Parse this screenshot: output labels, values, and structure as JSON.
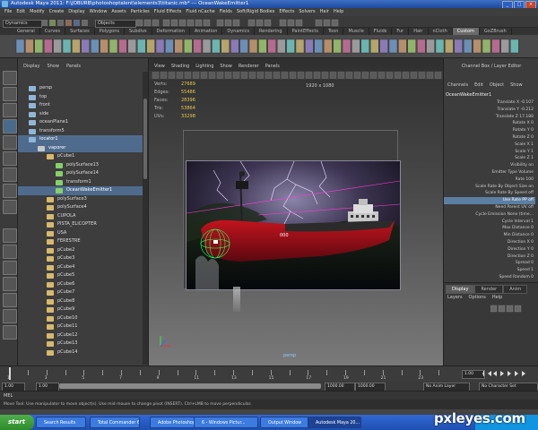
{
  "window": {
    "title": "Autodesk Maya 2011: F:\\JOBURB\\photoshoptalent\\elements3\\titanic.mb*  ---  OceanWakeEmitter1",
    "buttons": [
      "_",
      "□",
      "×"
    ]
  },
  "menubar": [
    "File",
    "Edit",
    "Modify",
    "Create",
    "Display",
    "Window",
    "Assets",
    "Particles",
    "Fluid Effects",
    "Fluid nCache",
    "Fields",
    "Soft/Rigid Bodies",
    "Effects",
    "Solvers",
    "Hair",
    "Help"
  ],
  "status_line": {
    "mode": "Dynamics",
    "selection": "Objects"
  },
  "shelf_tabs": [
    "General",
    "Curves",
    "Surfaces",
    "Polygons",
    "Subdivs",
    "Deformation",
    "Animation",
    "Dynamics",
    "Rendering",
    "PaintEffects",
    "Toon",
    "Muscle",
    "Fluids",
    "Fur",
    "Hair",
    "nCloth",
    "Custom",
    "GoZBrush"
  ],
  "shelf_active": "Custom",
  "outliner": {
    "menu": [
      "Display",
      "Show",
      "Panels"
    ],
    "items": [
      {
        "label": "persp",
        "indent": 0,
        "selected": false
      },
      {
        "label": "top",
        "indent": 0,
        "selected": false
      },
      {
        "label": "front",
        "indent": 0,
        "selected": false
      },
      {
        "label": "side",
        "indent": 0,
        "selected": false
      },
      {
        "label": "oceanPlane1",
        "indent": 0,
        "selected": false
      },
      {
        "label": "transform5",
        "indent": 0,
        "selected": false
      },
      {
        "label": "locator1",
        "indent": 0,
        "selected": true
      },
      {
        "label": "vaporer",
        "indent": 1,
        "selected": true
      },
      {
        "label": "pCube1",
        "indent": 2,
        "selected": false
      },
      {
        "label": "polySurface13",
        "indent": 3,
        "selected": false
      },
      {
        "label": "polySurface14",
        "indent": 3,
        "selected": false
      },
      {
        "label": "transform1",
        "indent": 3,
        "selected": false
      },
      {
        "label": "OceanWakeEmitter1",
        "indent": 3,
        "selected": true
      },
      {
        "label": "polySurface3",
        "indent": 2,
        "selected": false
      },
      {
        "label": "polySurface4",
        "indent": 2,
        "selected": false
      },
      {
        "label": "CUPOLA",
        "indent": 2,
        "selected": false
      },
      {
        "label": "PISTA_ELICOPTER",
        "indent": 2,
        "selected": false
      },
      {
        "label": "USA",
        "indent": 2,
        "selected": false
      },
      {
        "label": "FERESTRE",
        "indent": 2,
        "selected": false
      },
      {
        "label": "pCube2",
        "indent": 2,
        "selected": false
      },
      {
        "label": "pCube3",
        "indent": 2,
        "selected": false
      },
      {
        "label": "pCube4",
        "indent": 2,
        "selected": false
      },
      {
        "label": "pCube5",
        "indent": 2,
        "selected": false
      },
      {
        "label": "pCube6",
        "indent": 2,
        "selected": false
      },
      {
        "label": "pCube7",
        "indent": 2,
        "selected": false
      },
      {
        "label": "pCube8",
        "indent": 2,
        "selected": false
      },
      {
        "label": "pCube9",
        "indent": 2,
        "selected": false
      },
      {
        "label": "pCube10",
        "indent": 2,
        "selected": false
      },
      {
        "label": "pCube11",
        "indent": 2,
        "selected": false
      },
      {
        "label": "pCube12",
        "indent": 2,
        "selected": false
      },
      {
        "label": "pCube13",
        "indent": 2,
        "selected": false
      },
      {
        "label": "pCube14",
        "indent": 2,
        "selected": false
      }
    ]
  },
  "viewport": {
    "menu": [
      "View",
      "Shading",
      "Lighting",
      "Show",
      "Renderer",
      "Panels"
    ],
    "hud": [
      {
        "label": "Verts:",
        "value": "27689"
      },
      {
        "label": "Edges:",
        "value": "55486"
      },
      {
        "label": "Faces:",
        "value": "28396"
      },
      {
        "label": "Tris:",
        "value": "53864"
      },
      {
        "label": "UVs:",
        "value": "33298"
      }
    ],
    "resolution": "1920 x 1080",
    "camera": "persp",
    "ship_text": "000"
  },
  "channel_box": {
    "header": "Channel Box / Layer Editor",
    "menu": [
      "Channels",
      "Edit",
      "Object",
      "Show"
    ],
    "object": "OceanWakeEmitter1",
    "attributes": [
      "Translate X -0.107",
      "Translate Y -0.212",
      "Translate Z 17.188",
      "Rotate X 0",
      "Rotate Y 0",
      "Rotate Z 0",
      "Scale X 1",
      "Scale Y 1",
      "Scale Z 1",
      "Visibility on",
      "Emitter Type Volume",
      "Rate 100",
      "Scale Rate By Object Size on",
      "Scale Rate By Speed off",
      "Use Rate PP off",
      "Need Parent UV off",
      "Cycle Emission None (time...",
      "Cycle Interval 1",
      "Max Distance 0",
      "Min Distance 0",
      "Direction X 0",
      "Direction Y 0",
      "Direction Z 0",
      "Spread 0",
      "Speed 1",
      "Speed Random 0"
    ],
    "highlighted_attr": "Use Rate PP off",
    "layer_tabs": [
      "Display",
      "Render",
      "Anim"
    ],
    "layer_menu": [
      "Layers",
      "Options",
      "Help"
    ]
  },
  "timeline": {
    "ticks": [
      "1",
      "2",
      "3",
      "4",
      "5",
      "6",
      "7",
      "8",
      "9",
      "10",
      "11",
      "12",
      "13",
      "14",
      "15",
      "16",
      "17",
      "18",
      "19",
      "20",
      "21",
      "22",
      "23",
      "24"
    ],
    "current": "1.00",
    "start": "1.00",
    "range_start": "1.00",
    "range_end": "1000.00",
    "end": "1000.00",
    "anim_layer": "No Anim Layer",
    "char_set": "No Character Set"
  },
  "mel_label": "MEL",
  "help_line": "Move Tool: Use manipulator to move object(s). Use mid mouse to change pivot (INSERT). Ctrl+LMB to move perpendicular.",
  "taskbar": {
    "start": "start",
    "items": [
      "Search Results",
      "Total Commander 6...",
      "Adobe Photoshop ...",
      "6 - Windows Pictur...",
      "Output Window",
      "Autodesk Maya 20..."
    ],
    "active": "Autodesk Maya 20..."
  },
  "watermark": "pxleyes.com"
}
